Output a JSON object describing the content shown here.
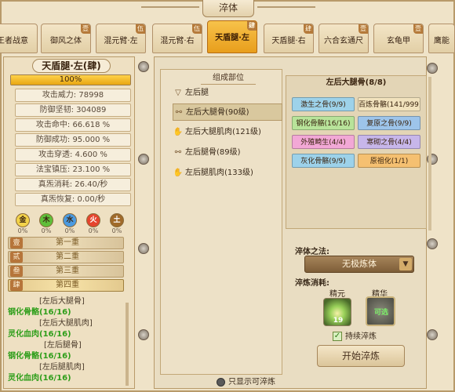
{
  "window": {
    "title": "淬体"
  },
  "tabs": [
    {
      "label": "王者战意",
      "badge": ""
    },
    {
      "label": "御风之体",
      "badge": "壹"
    },
    {
      "label": "混元臂·左",
      "badge": "伍"
    },
    {
      "label": "混元臂·右",
      "badge": "伍"
    },
    {
      "label": "天盾腿·左",
      "badge": "肆",
      "active": true
    },
    {
      "label": "天盾腿·右",
      "badge": "肆"
    },
    {
      "label": "六合玄通尺",
      "badge": "壹"
    },
    {
      "label": "玄龟甲",
      "badge": "壹"
    },
    {
      "label": "鹰能",
      "badge": ""
    }
  ],
  "left": {
    "title": "天盾腿·左(肆)",
    "progress": {
      "text": "100%",
      "fraction": 1.0
    },
    "stats": [
      "攻击威力: 78998",
      "防御坚韧: 304089",
      "攻击命中: 66.618 %",
      "防御成功: 95.000 %",
      "攻击穿透: 4.600 %",
      "法宝镇压: 23.100 %",
      "真炁消耗: 26.40/秒",
      "真炁恢复: 0.00/秒"
    ],
    "elements": [
      {
        "char": "金",
        "pct": "0%",
        "color": "#f2d24a"
      },
      {
        "char": "木",
        "pct": "0%",
        "color": "#5fbf3a"
      },
      {
        "char": "水",
        "pct": "0%",
        "color": "#4a9ae0"
      },
      {
        "char": "火",
        "pct": "0%",
        "color": "#e5452e"
      },
      {
        "char": "土",
        "pct": "0%",
        "color": "#a06a2a"
      }
    ],
    "levels": [
      {
        "badge": "壹",
        "name": "第一重"
      },
      {
        "badge": "贰",
        "name": "第二重"
      },
      {
        "badge": "叁",
        "name": "第三重"
      },
      {
        "badge": "肆",
        "name": "第四重",
        "active": true
      }
    ],
    "log": [
      {
        "text": "[左后大腿骨]",
        "type": "part"
      },
      {
        "text": "钢化骨骼(16/16)",
        "type": "result"
      },
      {
        "text": "[左后大腿肌肉]",
        "type": "part"
      },
      {
        "text": "灵化血肉(16/16)",
        "type": "result"
      },
      {
        "text": "[左后腿骨]",
        "type": "part"
      },
      {
        "text": "钢化骨骼(16/16)",
        "type": "result"
      },
      {
        "text": "[左后腿肌肉]",
        "type": "part"
      },
      {
        "text": "灵化血肉(16/16)",
        "type": "result"
      }
    ]
  },
  "parts": {
    "header": "组成部位",
    "root": "左后腿",
    "items": [
      {
        "label": "左后大腿骨(90级)",
        "icon": "bone-icon",
        "selected": true
      },
      {
        "label": "左后大腿肌肉(121级)",
        "icon": "muscle-icon"
      },
      {
        "label": "左后腿骨(89级)",
        "icon": "bone-icon"
      },
      {
        "label": "左后腿肌肉(133级)",
        "icon": "muscle-icon"
      }
    ]
  },
  "bones": {
    "title": "左后大腿骨(8/8)",
    "items": [
      {
        "label": "激生之骨(9/9)",
        "color": "#9dd2ea"
      },
      {
        "label": "百炼骨骼(141/999)",
        "color": "#f1e2bd"
      },
      {
        "label": "钢化骨骼(16/16)",
        "color": "#b8e39a"
      },
      {
        "label": "复原之骨(9/9)",
        "color": "#9dc4ea"
      },
      {
        "label": "外殖畸生(4/4)",
        "color": "#f2a8d6"
      },
      {
        "label": "寒砌之骨(4/4)",
        "color": "#c7b6ea"
      },
      {
        "label": "灰化骨骼(9/9)",
        "color": "#9dd2ea"
      },
      {
        "label": "原祖化(1/1)",
        "color": "#f5c071"
      }
    ]
  },
  "method": {
    "label": "淬体之法:",
    "selected": "无极炼体"
  },
  "cost": {
    "label": "淬炼消耗:",
    "resources": [
      {
        "name": "精元",
        "count": "19"
      },
      {
        "name": "精华",
        "count": "可选"
      }
    ]
  },
  "continue_label": "持续淬炼",
  "start_button": "开始淬炼",
  "show_only_label": "只显示可淬炼"
}
